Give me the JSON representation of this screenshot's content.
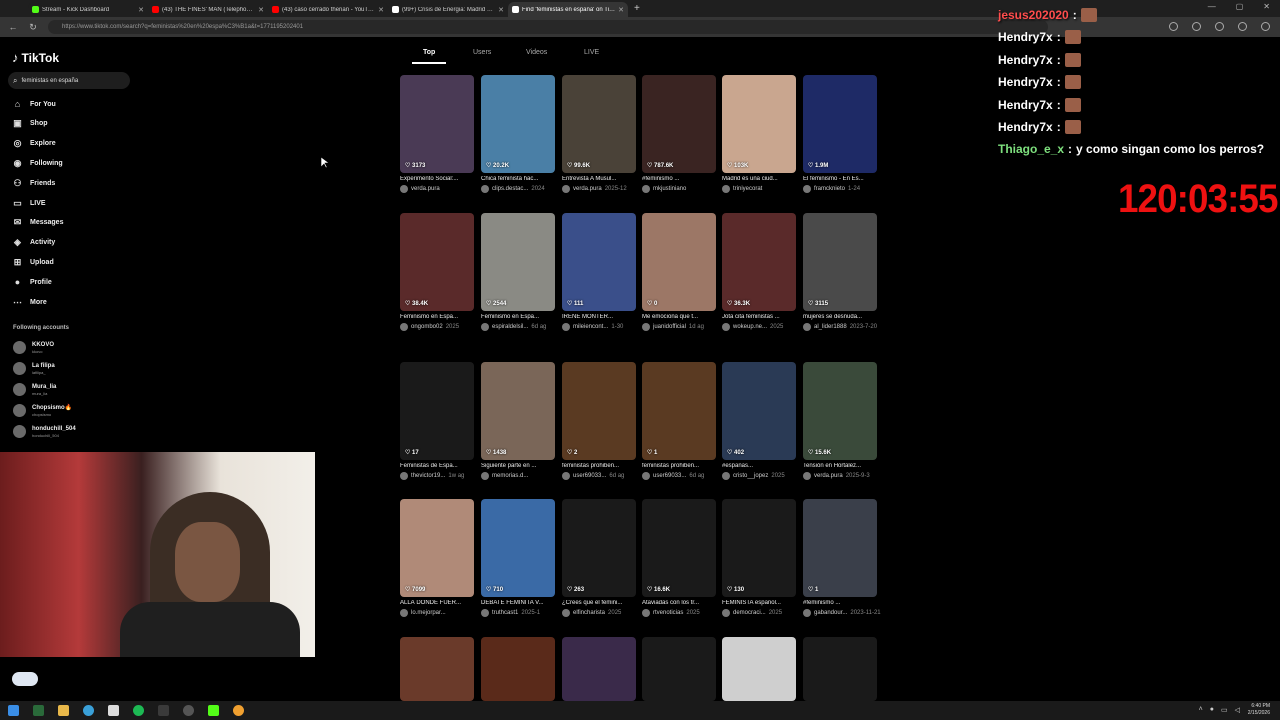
{
  "browser": {
    "tabs": [
      {
        "label": "Stream - Kick Dashboard",
        "color": "#53fc18",
        "active": false
      },
      {
        "label": "(43) THE FINES' MAN (Telephone ...",
        "color": "#ff0000",
        "active": false
      },
      {
        "label": "(43) caso cerrado therian - YouTu...",
        "color": "#ff0000",
        "active": false
      },
      {
        "label": "(99+) Crisis de Energia: Madrid Sin...",
        "color": "#ffffff",
        "active": false
      },
      {
        "label": "Find 'feministas en españa' on TikTok",
        "color": "#ffffff",
        "active": true
      }
    ],
    "url": "https://www.tiktok.com/search?q=feministas%20en%20espa%C3%B1a&t=1771195202401"
  },
  "tiktok": {
    "logo": "TikTok",
    "search_value": "feministas en españa",
    "nav": [
      {
        "label": "For You",
        "icon": "home-icon",
        "glyph": "⌂"
      },
      {
        "label": "Shop",
        "icon": "shop-icon",
        "glyph": "▣"
      },
      {
        "label": "Explore",
        "icon": "explore-icon",
        "glyph": "◎"
      },
      {
        "label": "Following",
        "icon": "following-icon",
        "glyph": "◉"
      },
      {
        "label": "Friends",
        "icon": "friends-icon",
        "glyph": "⚇"
      },
      {
        "label": "LIVE",
        "icon": "live-icon",
        "glyph": "▭"
      },
      {
        "label": "Messages",
        "icon": "messages-icon",
        "glyph": "✉"
      },
      {
        "label": "Activity",
        "icon": "activity-icon",
        "glyph": "◈"
      },
      {
        "label": "Upload",
        "icon": "upload-icon",
        "glyph": "⊞"
      },
      {
        "label": "Profile",
        "icon": "profile-icon",
        "glyph": "●"
      },
      {
        "label": "More",
        "icon": "more-icon",
        "glyph": "⋯"
      }
    ],
    "following_title": "Following accounts",
    "following": [
      {
        "name": "KKOVO",
        "handle": "kkovo"
      },
      {
        "name": "La filipa",
        "handle": "lafilipa_"
      },
      {
        "name": "Mura_lia",
        "handle": "mura_lia"
      },
      {
        "name": "Chopsismo🔥",
        "handle": "chopsismo"
      },
      {
        "name": "honduchill_504",
        "handle": "honduchill_504"
      }
    ],
    "top_tabs": [
      "Top",
      "Users",
      "Videos",
      "LIVE"
    ],
    "videos": [
      {
        "likes": "3173",
        "caption": "Experimento Social:...",
        "user": "verda.pura",
        "date": "",
        "color": "#4a3a55"
      },
      {
        "likes": "20.2K",
        "caption": "Chica feminista hac...",
        "user": "clips.destac...",
        "date": "2024",
        "color": "#4a7fa6"
      },
      {
        "likes": "99.6K",
        "caption": "Entrevista A Musul...",
        "user": "verda.pura",
        "date": "2025-12",
        "color": "#4a4238"
      },
      {
        "likes": "787.6K",
        "caption": "#feminismo ...",
        "user": "mkjustiniano",
        "date": "",
        "color": "#3a2422"
      },
      {
        "likes": "103K",
        "caption": "Madrid es una ciud...",
        "user": "triniyecorat",
        "date": "",
        "color": "#c9a68f"
      },
      {
        "likes": "1.9M",
        "caption": "El feminismo - En Es...",
        "user": "framcknieto",
        "date": "1-24",
        "color": "#1e2a66"
      },
      {
        "likes": "38.4K",
        "caption": "Feminismo en Espa...",
        "user": "ongombo02",
        "date": "2025",
        "color": "#5a2a2a"
      },
      {
        "likes": "2544",
        "caption": "Feminismo en Espa...",
        "user": "espiraldelsil...",
        "date": "6d ag",
        "color": "#8a8a84"
      },
      {
        "likes": "111",
        "caption": "IRENE MONTER...",
        "user": "mileiencont...",
        "date": "1-30",
        "color": "#3a4f8a"
      },
      {
        "likes": "0",
        "caption": "Me emociona que t...",
        "user": "juanidofficial",
        "date": "1d ag",
        "color": "#9c7766"
      },
      {
        "likes": "36.3K",
        "caption": "Jota cita feministas ...",
        "user": "wokeup.ne...",
        "date": "2025",
        "color": "#5a2a2a"
      },
      {
        "likes": "3115",
        "caption": "mujeres se desnuda...",
        "user": "al_lider1888",
        "date": "2023-7-20",
        "color": "#4a4a4a"
      },
      {
        "likes": "17",
        "caption": "Feministas de Espa...",
        "user": "thevictor19...",
        "date": "1w ag",
        "color": "#1a1a1a"
      },
      {
        "likes": "1438",
        "caption": "Siguiente parte en ...",
        "user": "memorias.d...",
        "date": "",
        "color": "#7a6658"
      },
      {
        "likes": "2",
        "caption": "feministas prohiben...",
        "user": "user69033...",
        "date": "6d ag",
        "color": "#5a3a22"
      },
      {
        "likes": "1",
        "caption": "feministas prohiben...",
        "user": "user69033...",
        "date": "6d ag",
        "color": "#5a3a22"
      },
      {
        "likes": "402",
        "caption": "#españas...",
        "user": "cristo__jopez",
        "date": "2025",
        "color": "#2a3a55"
      },
      {
        "likes": "15.6K",
        "caption": "Tensión en Hortalez...",
        "user": "verda.pura",
        "date": "2025-9-3",
        "color": "#3a4a3a"
      },
      {
        "likes": "7099",
        "caption": "ALLÁ DONDE FUER...",
        "user": "lo.mejorpar...",
        "date": "",
        "color": "#b08a78"
      },
      {
        "likes": "710",
        "caption": "DEBATE FEMINITA V...",
        "user": "truthcast1",
        "date": "2025-1",
        "color": "#3a6aa6"
      },
      {
        "likes": "263",
        "caption": "¿Crees que el femini...",
        "user": "elfincharista",
        "date": "2025",
        "color": "#1a1a1a"
      },
      {
        "likes": "16.6K",
        "caption": "Ataviadas con los tr...",
        "user": "rtvenoticias",
        "date": "2025",
        "color": "#1a1a1a"
      },
      {
        "likes": "130",
        "caption": "FEMINISTA español...",
        "user": "democraci...",
        "date": "2025",
        "color": "#1a1a1a"
      },
      {
        "likes": "1",
        "caption": "#feminismo ...",
        "user": "gabandour...",
        "date": "2023-11-21",
        "color": "#3a3f4a"
      },
      {
        "likes": "",
        "caption": "",
        "user": "",
        "date": "",
        "color": "#6a3a2a"
      },
      {
        "likes": "",
        "caption": "",
        "user": "",
        "date": "",
        "color": "#5a2a1a"
      },
      {
        "likes": "",
        "caption": "",
        "user": "",
        "date": "",
        "color": "#3a2a4a"
      },
      {
        "likes": "",
        "caption": "",
        "user": "",
        "date": "",
        "color": "#1a1a1a"
      },
      {
        "likes": "",
        "caption": "",
        "user": "",
        "date": "",
        "color": "#cfcfcf"
      },
      {
        "likes": "",
        "caption": "",
        "user": "",
        "date": "",
        "color": "#1a1a1a"
      }
    ]
  },
  "chat": [
    {
      "user": "jesus202020",
      "text": "",
      "color": "#ff4d4d"
    },
    {
      "user": "Hendry7x",
      "text": "",
      "color": "#ffffff"
    },
    {
      "user": "Hendry7x",
      "text": "",
      "color": "#ffffff"
    },
    {
      "user": "Hendry7x",
      "text": "",
      "color": "#ffffff"
    },
    {
      "user": "Hendry7x",
      "text": "",
      "color": "#ffffff"
    },
    {
      "user": "Hendry7x",
      "text": "",
      "color": "#ffffff"
    },
    {
      "user": "Thiago_e_x",
      "text": "y como singan como los perros?",
      "color": "#7ee07e"
    }
  ],
  "timer": "120:03:55",
  "taskbar": {
    "time": "6:40 PM",
    "date": "2/15/2026"
  }
}
